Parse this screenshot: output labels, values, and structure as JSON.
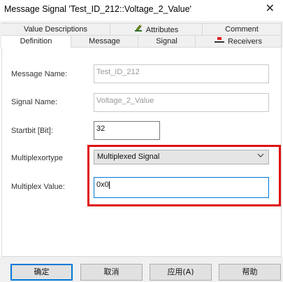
{
  "window": {
    "title": "Message Signal 'Test_ID_212::Voltage_2_Value'",
    "close_glyph": "✕"
  },
  "tabs": {
    "row1": [
      {
        "label": "Value Descriptions",
        "icon": ""
      },
      {
        "label": "Attributes",
        "icon": "attributes-pencil-icon"
      },
      {
        "label": "Comment",
        "icon": ""
      }
    ],
    "row2": [
      {
        "label": "Definition",
        "icon": "",
        "active": true
      },
      {
        "label": "Message",
        "icon": ""
      },
      {
        "label": "Signal",
        "icon": ""
      },
      {
        "label": "Receivers",
        "icon": "receivers-icon"
      }
    ]
  },
  "form": {
    "message_name": {
      "label": "Message Name:",
      "value": "Test_ID_212"
    },
    "signal_name": {
      "label": "Signal Name:",
      "value": "Voltage_2_Value"
    },
    "startbit": {
      "label": "Startbit [Bit]:",
      "value": "32"
    },
    "multiplexortype": {
      "label": "Multiplexortype",
      "value": "Multiplexed Signal"
    },
    "multiplex_value": {
      "label": "Multiplex Value:",
      "value": "0x0"
    }
  },
  "buttons": {
    "ok": "确定",
    "cancel": "取消",
    "apply": "应用(A)",
    "help": "帮助"
  },
  "colors": {
    "highlight": "#e01010",
    "focus": "#0078d7",
    "tab_bg": "#f0f0f0"
  }
}
